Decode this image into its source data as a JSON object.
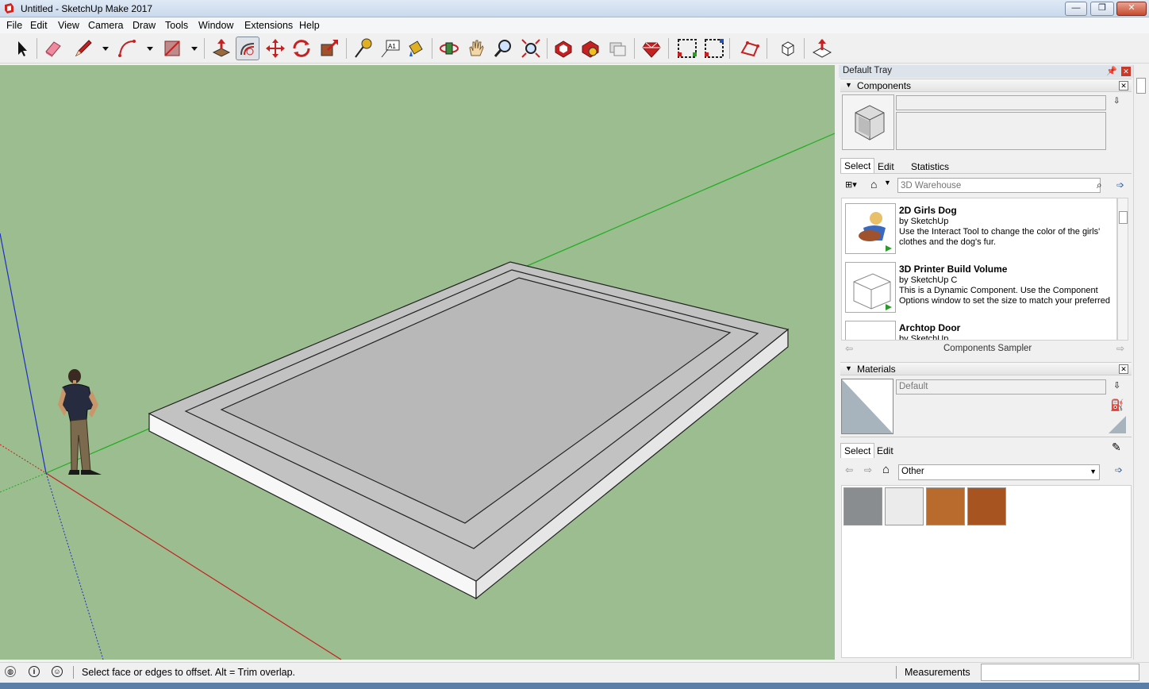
{
  "window": {
    "title": "Untitled - SketchUp Make 2017",
    "minimize_label": "—",
    "restore_label": "❐",
    "close_label": "✕"
  },
  "menu": [
    "File",
    "Edit",
    "View",
    "Camera",
    "Draw",
    "Tools",
    "Window",
    "Extensions",
    "Help"
  ],
  "toolbar_icons": [
    "select-tool",
    "eraser-tool",
    "line-tool",
    "arc-tool",
    "rectangle-tool",
    "push-pull-tool",
    "offset-tool",
    "move-tool",
    "rotate-tool",
    "scale-tool",
    "tape-measure-tool",
    "text-tool",
    "paint-bucket-tool",
    "orbit-tool",
    "pan-tool",
    "zoom-tool",
    "zoom-extents-tool",
    "3d-warehouse",
    "extension-warehouse",
    "layout",
    "extension-manager",
    "section-plane-1",
    "section-plane-2",
    "sandbox-tool",
    "component-tool",
    "style-tool"
  ],
  "tray": {
    "title": "Default Tray",
    "components": {
      "header": "Components",
      "name_value": "",
      "description_value": "",
      "tabs": [
        "Select",
        "Edit",
        "Statistics"
      ],
      "search_placeholder": "3D Warehouse",
      "items": [
        {
          "name": "2D Girls Dog",
          "by": "by SketchUp",
          "desc": "Use the Interact Tool to change the color of the girls' clothes and the dog's fur."
        },
        {
          "name": "3D Printer Build Volume",
          "by": "by SketchUp C",
          "desc": "This is a Dynamic Component. Use the Component Options window to set the size to match your preferred ..."
        },
        {
          "name": "Archtop Door",
          "by": "by SketchUp",
          "desc": ""
        }
      ],
      "collection": "Components Sampler"
    },
    "materials": {
      "header": "Materials",
      "name_value": "Default",
      "tabs": [
        "Select",
        "Edit"
      ],
      "library": "Other",
      "swatch_colors": [
        "#8a8d8f",
        "#ebebeb",
        "#b86b2c",
        "#a75420"
      ]
    }
  },
  "statusbar": {
    "message": "Select face or edges to offset. Alt = Trim overlap.",
    "measurements_label": "Measurements",
    "measurements_value": ""
  },
  "colors": {
    "ground": "#9bbd8f",
    "x_axis": "#c41f1f",
    "y_axis": "#1fae1f",
    "z_axis": "#1f2ec4"
  }
}
